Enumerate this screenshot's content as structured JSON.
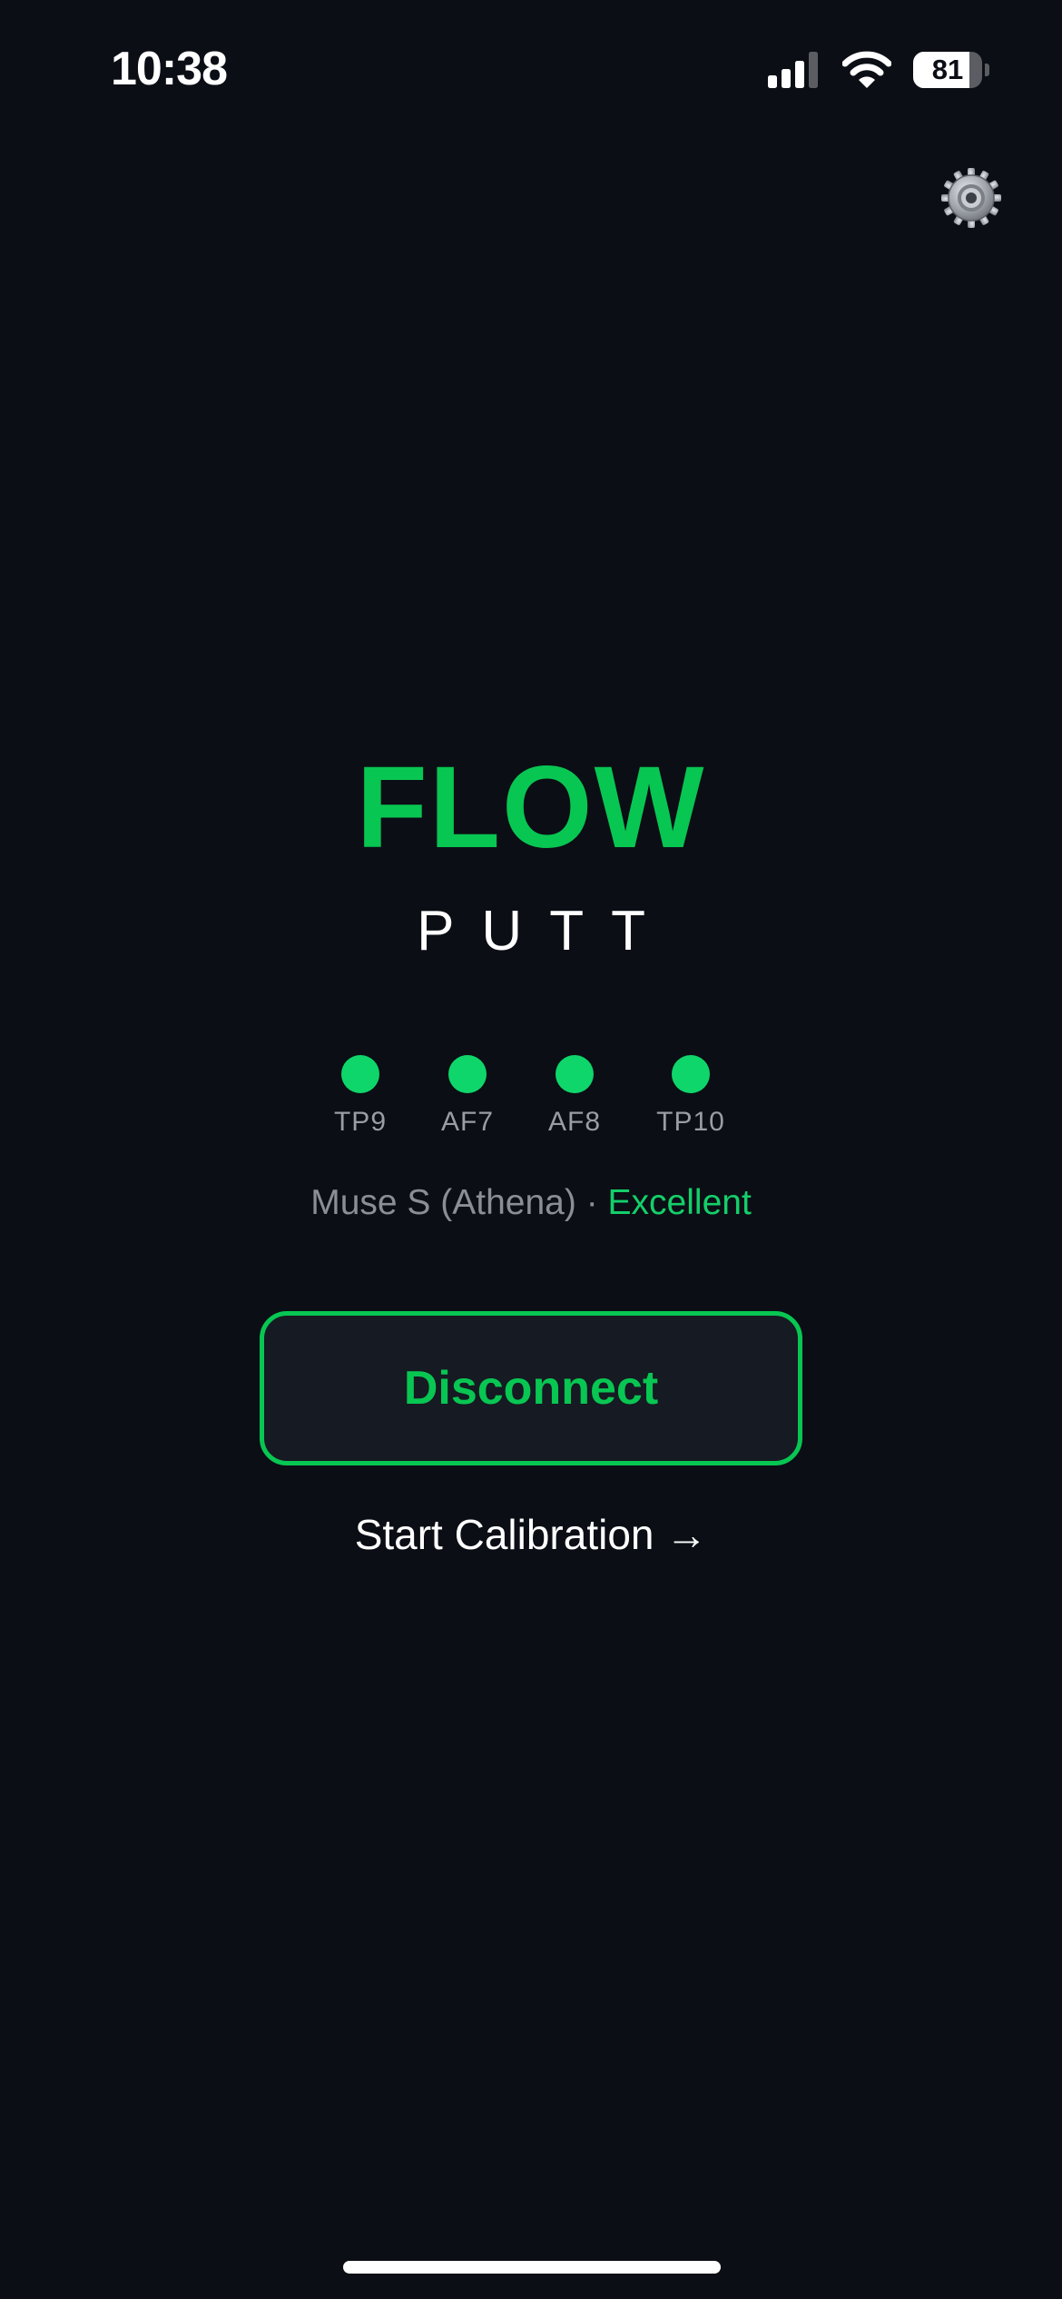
{
  "status_bar": {
    "time": "10:38",
    "battery_level": "81",
    "battery_fraction": 0.81,
    "icons": [
      "signal-icon",
      "wifi-icon",
      "battery-icon"
    ]
  },
  "settings": {
    "icon": "gear-icon"
  },
  "brand": {
    "title": "FLOW",
    "subtitle": "PUTT"
  },
  "sensors": [
    {
      "label": "TP9"
    },
    {
      "label": "AF7"
    },
    {
      "label": "AF8"
    },
    {
      "label": "TP10"
    }
  ],
  "device": {
    "name": "Muse S (Athena)",
    "separator": " · ",
    "quality": "Excellent"
  },
  "actions": {
    "disconnect_label": "Disconnect",
    "calibration_label": "Start Calibration →"
  },
  "colors": {
    "background": "#0b0e15",
    "accent": "#08c652",
    "sensor_ok": "#0fd66a",
    "quality_text": "#14cf6a",
    "muted_text": "#8b8e94"
  }
}
